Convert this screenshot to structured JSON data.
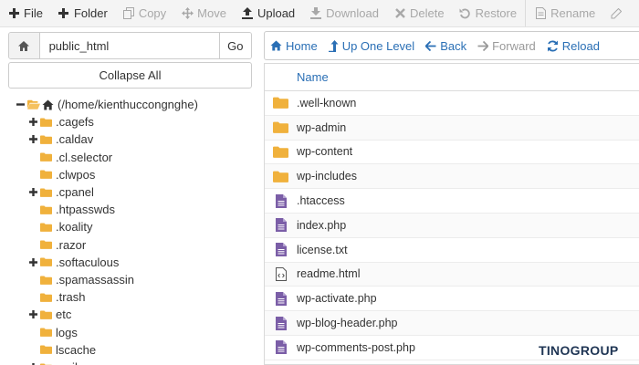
{
  "toolbar": [
    {
      "key": "file",
      "label": "File",
      "icon": "plus-icon",
      "enabled": true
    },
    {
      "key": "folder",
      "label": "Folder",
      "icon": "plus-icon",
      "enabled": true
    },
    {
      "key": "copy",
      "label": "Copy",
      "icon": "copy-icon",
      "enabled": false
    },
    {
      "key": "move",
      "label": "Move",
      "icon": "move-arrows-icon",
      "enabled": false
    },
    {
      "key": "upload",
      "label": "Upload",
      "icon": "upload-icon",
      "enabled": true
    },
    {
      "key": "download",
      "label": "Download",
      "icon": "download-icon",
      "enabled": false
    },
    {
      "key": "delete",
      "label": "Delete",
      "icon": "x-icon",
      "enabled": false
    },
    {
      "key": "restore",
      "label": "Restore",
      "icon": "undo-icon",
      "enabled": false
    },
    {
      "key": "rename",
      "label": "Rename",
      "icon": "document-icon",
      "enabled": false
    },
    {
      "key": "edit",
      "label": "",
      "icon": "pencil-icon",
      "enabled": false
    }
  ],
  "path_bar": {
    "value": "public_html",
    "go_label": "Go"
  },
  "collapse_label": "Collapse All",
  "tree": [
    {
      "label": "(/home/kienthuccongnghe)",
      "level": 0,
      "toggle": "minus",
      "icon": "home-folder"
    },
    {
      "label": ".cagefs",
      "level": 1,
      "toggle": "plus",
      "icon": "folder"
    },
    {
      "label": ".caldav",
      "level": 1,
      "toggle": "plus",
      "icon": "folder"
    },
    {
      "label": ".cl.selector",
      "level": 1,
      "toggle": "",
      "icon": "folder"
    },
    {
      "label": ".clwpos",
      "level": 1,
      "toggle": "",
      "icon": "folder"
    },
    {
      "label": ".cpanel",
      "level": 1,
      "toggle": "plus",
      "icon": "folder"
    },
    {
      "label": ".htpasswds",
      "level": 1,
      "toggle": "",
      "icon": "folder"
    },
    {
      "label": ".koality",
      "level": 1,
      "toggle": "",
      "icon": "folder"
    },
    {
      "label": ".razor",
      "level": 1,
      "toggle": "",
      "icon": "folder"
    },
    {
      "label": ".softaculous",
      "level": 1,
      "toggle": "plus",
      "icon": "folder"
    },
    {
      "label": ".spamassassin",
      "level": 1,
      "toggle": "",
      "icon": "folder"
    },
    {
      "label": ".trash",
      "level": 1,
      "toggle": "",
      "icon": "folder"
    },
    {
      "label": "etc",
      "level": 1,
      "toggle": "plus",
      "icon": "folder"
    },
    {
      "label": "logs",
      "level": 1,
      "toggle": "",
      "icon": "folder"
    },
    {
      "label": "lscache",
      "level": 1,
      "toggle": "",
      "icon": "folder"
    },
    {
      "label": "mail",
      "level": 1,
      "toggle": "plus",
      "icon": "folder"
    }
  ],
  "nav": [
    {
      "key": "home",
      "label": "Home",
      "icon": "home-icon",
      "enabled": true
    },
    {
      "key": "up",
      "label": "Up One Level",
      "icon": "level-up-icon",
      "enabled": true
    },
    {
      "key": "back",
      "label": "Back",
      "icon": "arrow-left-icon",
      "enabled": true
    },
    {
      "key": "forward",
      "label": "Forward",
      "icon": "arrow-right-icon",
      "enabled": false
    },
    {
      "key": "reload",
      "label": "Reload",
      "icon": "reload-icon",
      "enabled": true
    }
  ],
  "table": {
    "name_header": "Name",
    "rows": [
      {
        "name": ".well-known",
        "type": "folder"
      },
      {
        "name": "wp-admin",
        "type": "folder"
      },
      {
        "name": "wp-content",
        "type": "folder"
      },
      {
        "name": "wp-includes",
        "type": "folder"
      },
      {
        "name": ".htaccess",
        "type": "file"
      },
      {
        "name": "index.php",
        "type": "file"
      },
      {
        "name": "license.txt",
        "type": "file"
      },
      {
        "name": "readme.html",
        "type": "html"
      },
      {
        "name": "wp-activate.php",
        "type": "file"
      },
      {
        "name": "wp-blog-header.php",
        "type": "file"
      },
      {
        "name": "wp-comments-post.php",
        "type": "file"
      }
    ]
  },
  "brand": {
    "part1": "TINO",
    "part2": "GROUP"
  },
  "colors": {
    "folder": "#f0b13c",
    "file": "#7b5ea7",
    "link": "#2a6fb5",
    "disabled": "#a8a8a8"
  }
}
